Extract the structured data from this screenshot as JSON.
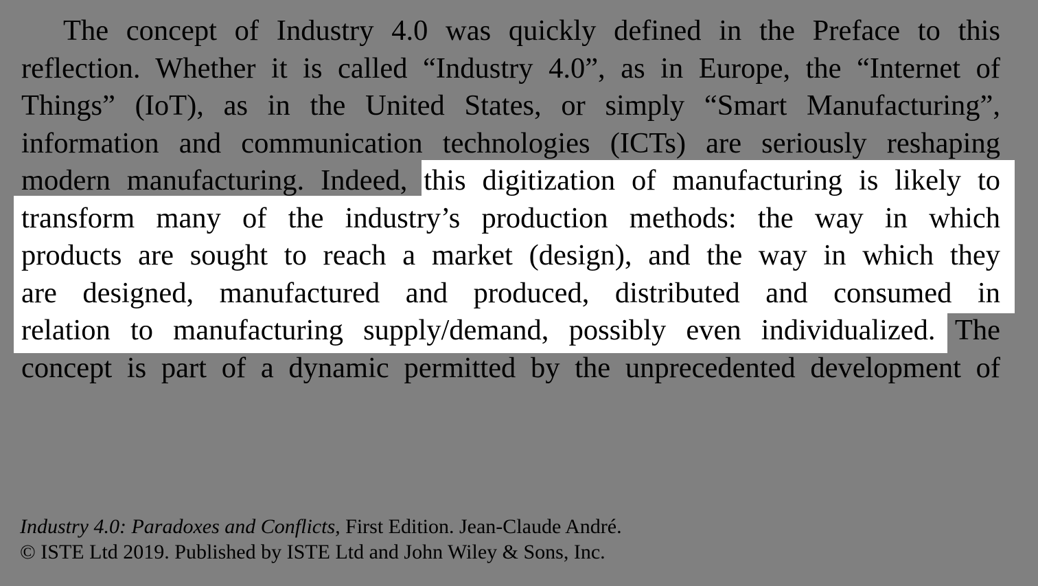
{
  "body": {
    "lines": [
      "The concept of Industry 4.0 was quickly defined in the Preface to this",
      "reflection. Whether it is called “Industry 4.0”, as in Europe, the “Internet of",
      "Things” (IoT), as in the United States, or simply “Smart Manufacturing”,",
      "information and communication technologies (ICTs) are seriously reshaping",
      "modern manufacturing. Indeed, this digitization of manufacturing is likely to",
      "transform many of the industry’s production methods: the way in which",
      "products are sought to reach a market (design), and the way in which they",
      "are designed, manufactured and produced, distributed and consumed in",
      "relation to manufacturing supply/demand, possibly even individualized. The",
      "concept is part of a dynamic permitted by the unprecedented development of"
    ]
  },
  "footer": {
    "book_title": "Industry 4.0: Paradoxes and Conflicts,",
    "edition_author": " First Edition. Jean-Claude André.",
    "copyright": "© ISTE Ltd 2019. Published by ISTE Ltd and John Wiley & Sons, Inc."
  },
  "colors": {
    "background": "#808080",
    "highlight": "#ffffff",
    "text": "#000000"
  }
}
